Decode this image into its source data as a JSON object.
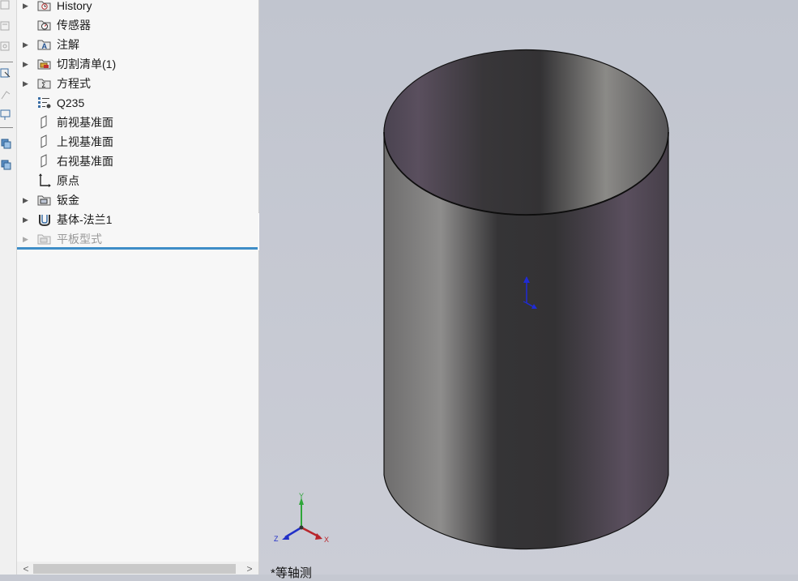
{
  "feature_tree": {
    "items": [
      {
        "label": "History",
        "icon": "history-folder-icon"
      },
      {
        "label": "传感器",
        "icon": "sensor-folder-icon"
      },
      {
        "label": "注解",
        "icon": "annotation-folder-icon"
      },
      {
        "label": "切割清单(1)",
        "icon": "cut-list-icon"
      },
      {
        "label": "方程式",
        "icon": "equations-folder-icon"
      },
      {
        "label": "Q235",
        "icon": "material-icon"
      },
      {
        "label": "前视基准面",
        "icon": "plane-icon"
      },
      {
        "label": "上视基准面",
        "icon": "plane-icon"
      },
      {
        "label": "右视基准面",
        "icon": "plane-icon"
      },
      {
        "label": "原点",
        "icon": "origin-icon"
      },
      {
        "label": "钣金",
        "icon": "sheet-metal-folder-icon"
      },
      {
        "label": "基体-法兰1",
        "icon": "base-flange-icon"
      },
      {
        "label": "平板型式",
        "icon": "flat-pattern-icon"
      }
    ]
  },
  "triad": {
    "x_label": "X",
    "y_label": "Y",
    "z_label": "Z"
  },
  "view": {
    "name": "*等轴测"
  },
  "colors": {
    "accent": "#3e8dc7",
    "viewport_bg": "#c5c8d1",
    "part": "#3c3b3d"
  }
}
